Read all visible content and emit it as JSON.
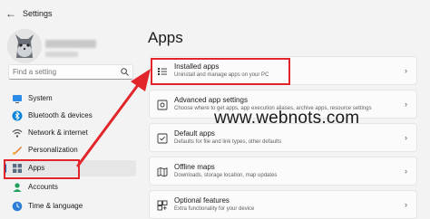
{
  "window": {
    "title": "Settings",
    "back_glyph": "←"
  },
  "sidebar": {
    "search_placeholder": "Find a setting",
    "items": [
      {
        "label": "System",
        "icon": "system-icon"
      },
      {
        "label": "Bluetooth & devices",
        "icon": "bluetooth-icon"
      },
      {
        "label": "Network & internet",
        "icon": "network-icon"
      },
      {
        "label": "Personalization",
        "icon": "personalization-icon"
      },
      {
        "label": "Apps",
        "icon": "apps-icon",
        "selected": true
      },
      {
        "label": "Accounts",
        "icon": "accounts-icon"
      },
      {
        "label": "Time & language",
        "icon": "time-language-icon"
      }
    ]
  },
  "main": {
    "title": "Apps",
    "cards": [
      {
        "title": "Installed apps",
        "subtitle": "Uninstall and manage apps on your PC",
        "icon": "installed-apps-icon"
      },
      {
        "title": "Advanced app settings",
        "subtitle": "Choose where to get apps, app execution aliases, archive apps, resource settings",
        "icon": "advanced-settings-icon"
      },
      {
        "title": "Default apps",
        "subtitle": "Defaults for file and link types, other defaults",
        "icon": "default-apps-icon"
      },
      {
        "title": "Offline maps",
        "subtitle": "Downloads, storage location, map updates",
        "icon": "offline-maps-icon"
      },
      {
        "title": "Optional features",
        "subtitle": "Extra functionality for your device",
        "icon": "optional-features-icon"
      }
    ]
  },
  "watermark": "www.webnots.com",
  "colors": {
    "highlight": "#e2252b",
    "accent": "#005fb8"
  }
}
